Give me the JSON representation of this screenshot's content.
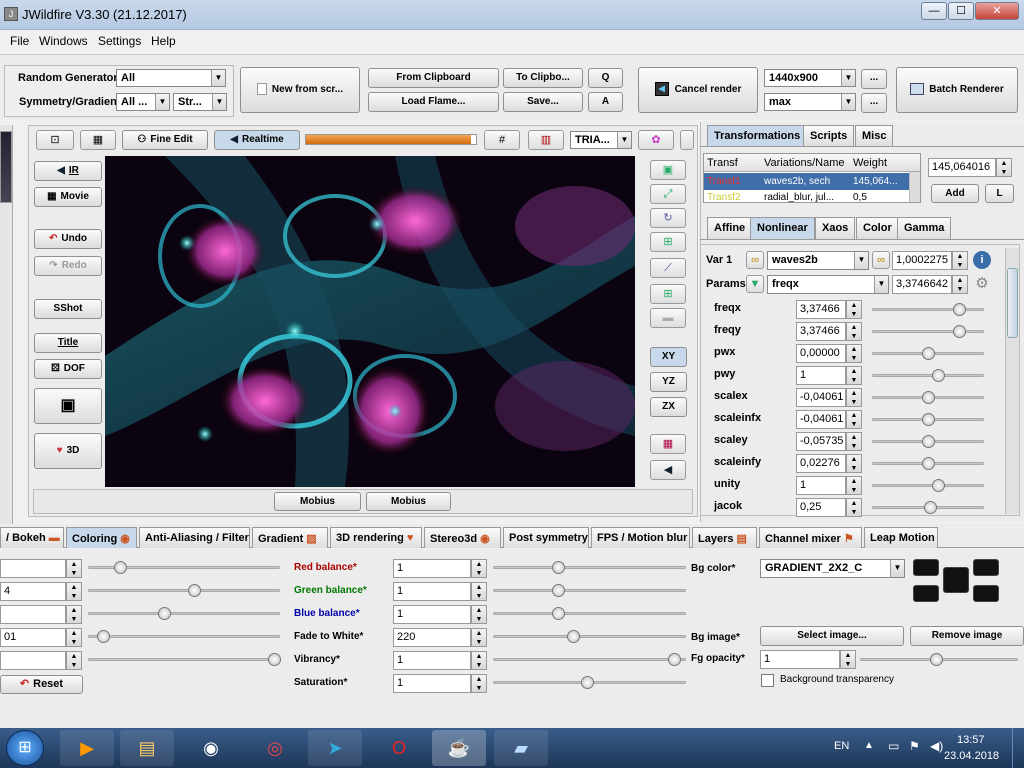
{
  "window": {
    "title": "JWildfire V3.30 (21.12.2017)",
    "minimize": "—",
    "maximize": "☐",
    "close": "✕"
  },
  "menu": [
    "File",
    "Windows",
    "Settings",
    "Help"
  ],
  "toolbar": {
    "random_generator_label": "Random Generator",
    "random_generator_value": "All",
    "symmetry_label": "Symmetry/Gradient",
    "symmetry_value": "All ...",
    "symmetry_value2": "Str...",
    "new_from_scratch": "New from scr...",
    "from_clipboard": "From Clipboard",
    "to_clipboard": "To Clipbo...",
    "q_button": "Q",
    "load_flame": "Load Flame...",
    "save": "Save...",
    "a_button": "A",
    "cancel_render": "Cancel render",
    "resolution": "1440x900",
    "quality": "max",
    "ellipsis": "...",
    "batch_renderer": "Batch Renderer"
  },
  "preview_toolbar": {
    "fine_edit": "Fine Edit",
    "realtime": "Realtime",
    "tria": "TRIA...",
    "progress": 0.97
  },
  "left_buttons": {
    "ir": "IR",
    "movie": "Movie",
    "undo": "Undo",
    "redo": "Redo",
    "sshot": "SShot",
    "title": "Title",
    "dof": "DOF",
    "three_d": "3D"
  },
  "right_view_buttons": {
    "xy": "XY",
    "yz": "YZ",
    "zx": "ZX"
  },
  "mobius": [
    "Mobius",
    "Mobius"
  ],
  "right_panel": {
    "tabs": [
      "Transformations",
      "Scripts",
      "Misc"
    ],
    "table_headers": [
      "Transf",
      "Variations/Name",
      "Weight"
    ],
    "table_rows": [
      {
        "transf": "Transf1",
        "name": "waves2b, sech",
        "weight": "145,064..."
      },
      {
        "transf": "Transf2",
        "name": "radial_blur, jul...",
        "weight": "0,5"
      }
    ],
    "weight_value": "145,064016",
    "add": "Add",
    "l": "L",
    "subtabs": [
      "Affine",
      "Nonlinear",
      "Xaos",
      "Color",
      "Gamma"
    ],
    "var_label": "Var 1",
    "var_value": "waves2b",
    "var_amount": "1,0002275",
    "params_label": "Params",
    "params_value": "freqx",
    "params_amount": "3,3746642",
    "params": [
      {
        "name": "freqx",
        "value": "3,37466",
        "pos": 0.78
      },
      {
        "name": "freqy",
        "value": "3,37466",
        "pos": 0.78
      },
      {
        "name": "pwx",
        "value": "0,00000",
        "pos": 0.5
      },
      {
        "name": "pwy",
        "value": "1",
        "pos": 0.59
      },
      {
        "name": "scalex",
        "value": "-0,04061",
        "pos": 0.5
      },
      {
        "name": "scaleinfx",
        "value": "-0,04061",
        "pos": 0.5
      },
      {
        "name": "scaley",
        "value": "-0,05735",
        "pos": 0.5
      },
      {
        "name": "scaleinfy",
        "value": "0,02276",
        "pos": 0.5
      },
      {
        "name": "unity",
        "value": "1",
        "pos": 0.59
      },
      {
        "name": "jacok",
        "value": "0,25",
        "pos": 0.52
      }
    ]
  },
  "bottom_tabs": [
    "/ Bokeh",
    "Coloring",
    "Anti-Aliasing / Filter",
    "Gradient",
    "3D rendering",
    "Stereo3d",
    "Post symmetry",
    "FPS / Motion blur",
    "Layers",
    "Channel mixer",
    "Leap Motion"
  ],
  "coloring": {
    "left_fields": [
      {
        "value": "",
        "pos": 0.17
      },
      {
        "value": "4",
        "pos": 0.57
      },
      {
        "value": "",
        "pos": 0.41
      },
      {
        "value": "01",
        "pos": 0.08
      },
      {
        "value": "",
        "pos": 1.0
      }
    ],
    "reset": "Reset",
    "rows": [
      {
        "label": "Red balance*",
        "value": "1",
        "color": "#aa0000",
        "pos": 0.35
      },
      {
        "label": "Green balance*",
        "value": "1",
        "color": "#007700",
        "pos": 0.35
      },
      {
        "label": "Blue balance*",
        "value": "1",
        "color": "#0000aa",
        "pos": 0.35
      },
      {
        "label": "Fade to White*",
        "value": "220",
        "color": "#000000",
        "pos": 0.43
      },
      {
        "label": "Vibrancy*",
        "value": "1",
        "color": "#000000",
        "pos": 0.97
      },
      {
        "label": "Saturation*",
        "value": "1",
        "color": "#000000",
        "pos": 0.5
      }
    ],
    "bg_color_label": "Bg color*",
    "bg_color_value": "GRADIENT_2X2_C",
    "bg_image_label": "Bg image*",
    "select_image": "Select image...",
    "remove_image": "Remove image",
    "fg_opacity_label": "Fg opacity*",
    "fg_opacity_value": "1",
    "fg_opacity_pos": 0.5,
    "bg_transparency": "Background transparency"
  },
  "taskbar": {
    "lang": "EN",
    "time": "13:57",
    "date": "23.04.2018"
  }
}
